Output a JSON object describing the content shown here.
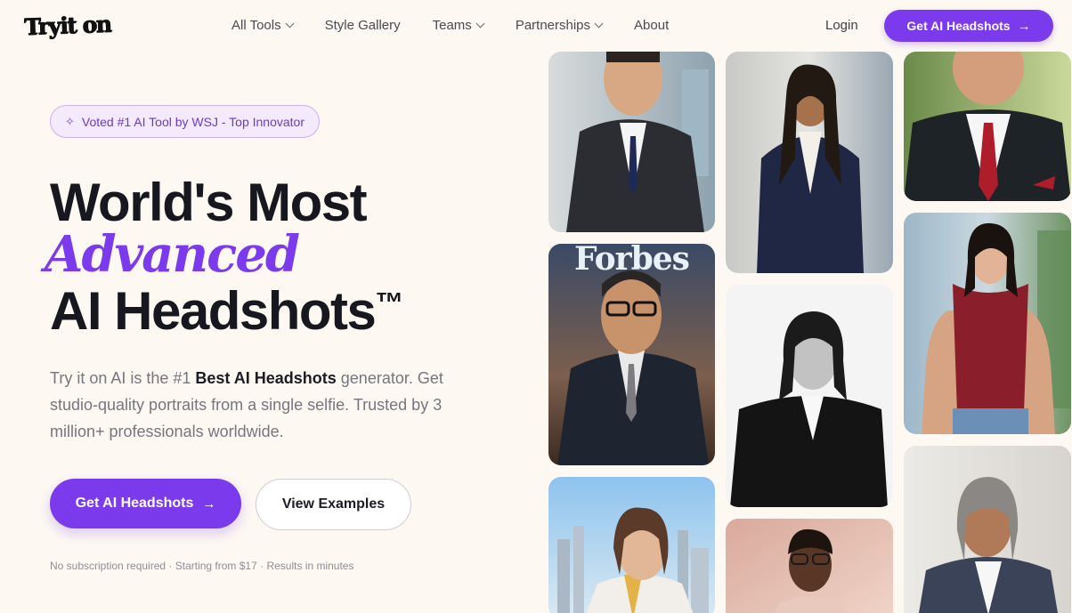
{
  "brand": {
    "logo_text": "Tryit on"
  },
  "nav": {
    "links": [
      {
        "label": "All Tools",
        "dropdown": true
      },
      {
        "label": "Style Gallery",
        "dropdown": false
      },
      {
        "label": "Teams",
        "dropdown": true
      },
      {
        "label": "Partnerships",
        "dropdown": true
      },
      {
        "label": "About",
        "dropdown": false
      }
    ],
    "login_label": "Login",
    "cta_label": "Get AI Headshots",
    "cta_icon": "arrow-right-icon"
  },
  "hero": {
    "badge_icon": "sparkle-icon",
    "badge_text": "Voted #1 AI Tool by WSJ - Top Innovator",
    "headline_line1": "World's Most",
    "headline_line2": "Advanced",
    "headline_line3": "AI Headshots",
    "trademark": "™",
    "desc_part1": "Try it on AI is the #1 ",
    "desc_bold": "Best AI Headshots",
    "desc_part2": " generator. Get studio-quality portraits from a single selfie. Trusted by 3 million+ professionals worldwide.",
    "primary_button": "Get AI Headshots",
    "secondary_button": "View Examples",
    "fine_print": "No subscription required · Starting from $17 · Results in minutes"
  },
  "gallery": {
    "magazine_title": "Forbes",
    "photos": [
      {
        "name": "headshot-asian-man-suit"
      },
      {
        "name": "headshot-forbes-cover"
      },
      {
        "name": "headshot-woman-skyline"
      },
      {
        "name": "headshot-woman-navy-suit"
      },
      {
        "name": "headshot-woman-black-white"
      },
      {
        "name": "headshot-woman-glasses-pink"
      },
      {
        "name": "headshot-man-red-tie"
      },
      {
        "name": "headshot-woman-red-top"
      },
      {
        "name": "headshot-woman-grey-hair"
      }
    ]
  },
  "colors": {
    "accent": "#7c3aed",
    "background": "#fdf9f2",
    "text": "#1c1c24"
  }
}
